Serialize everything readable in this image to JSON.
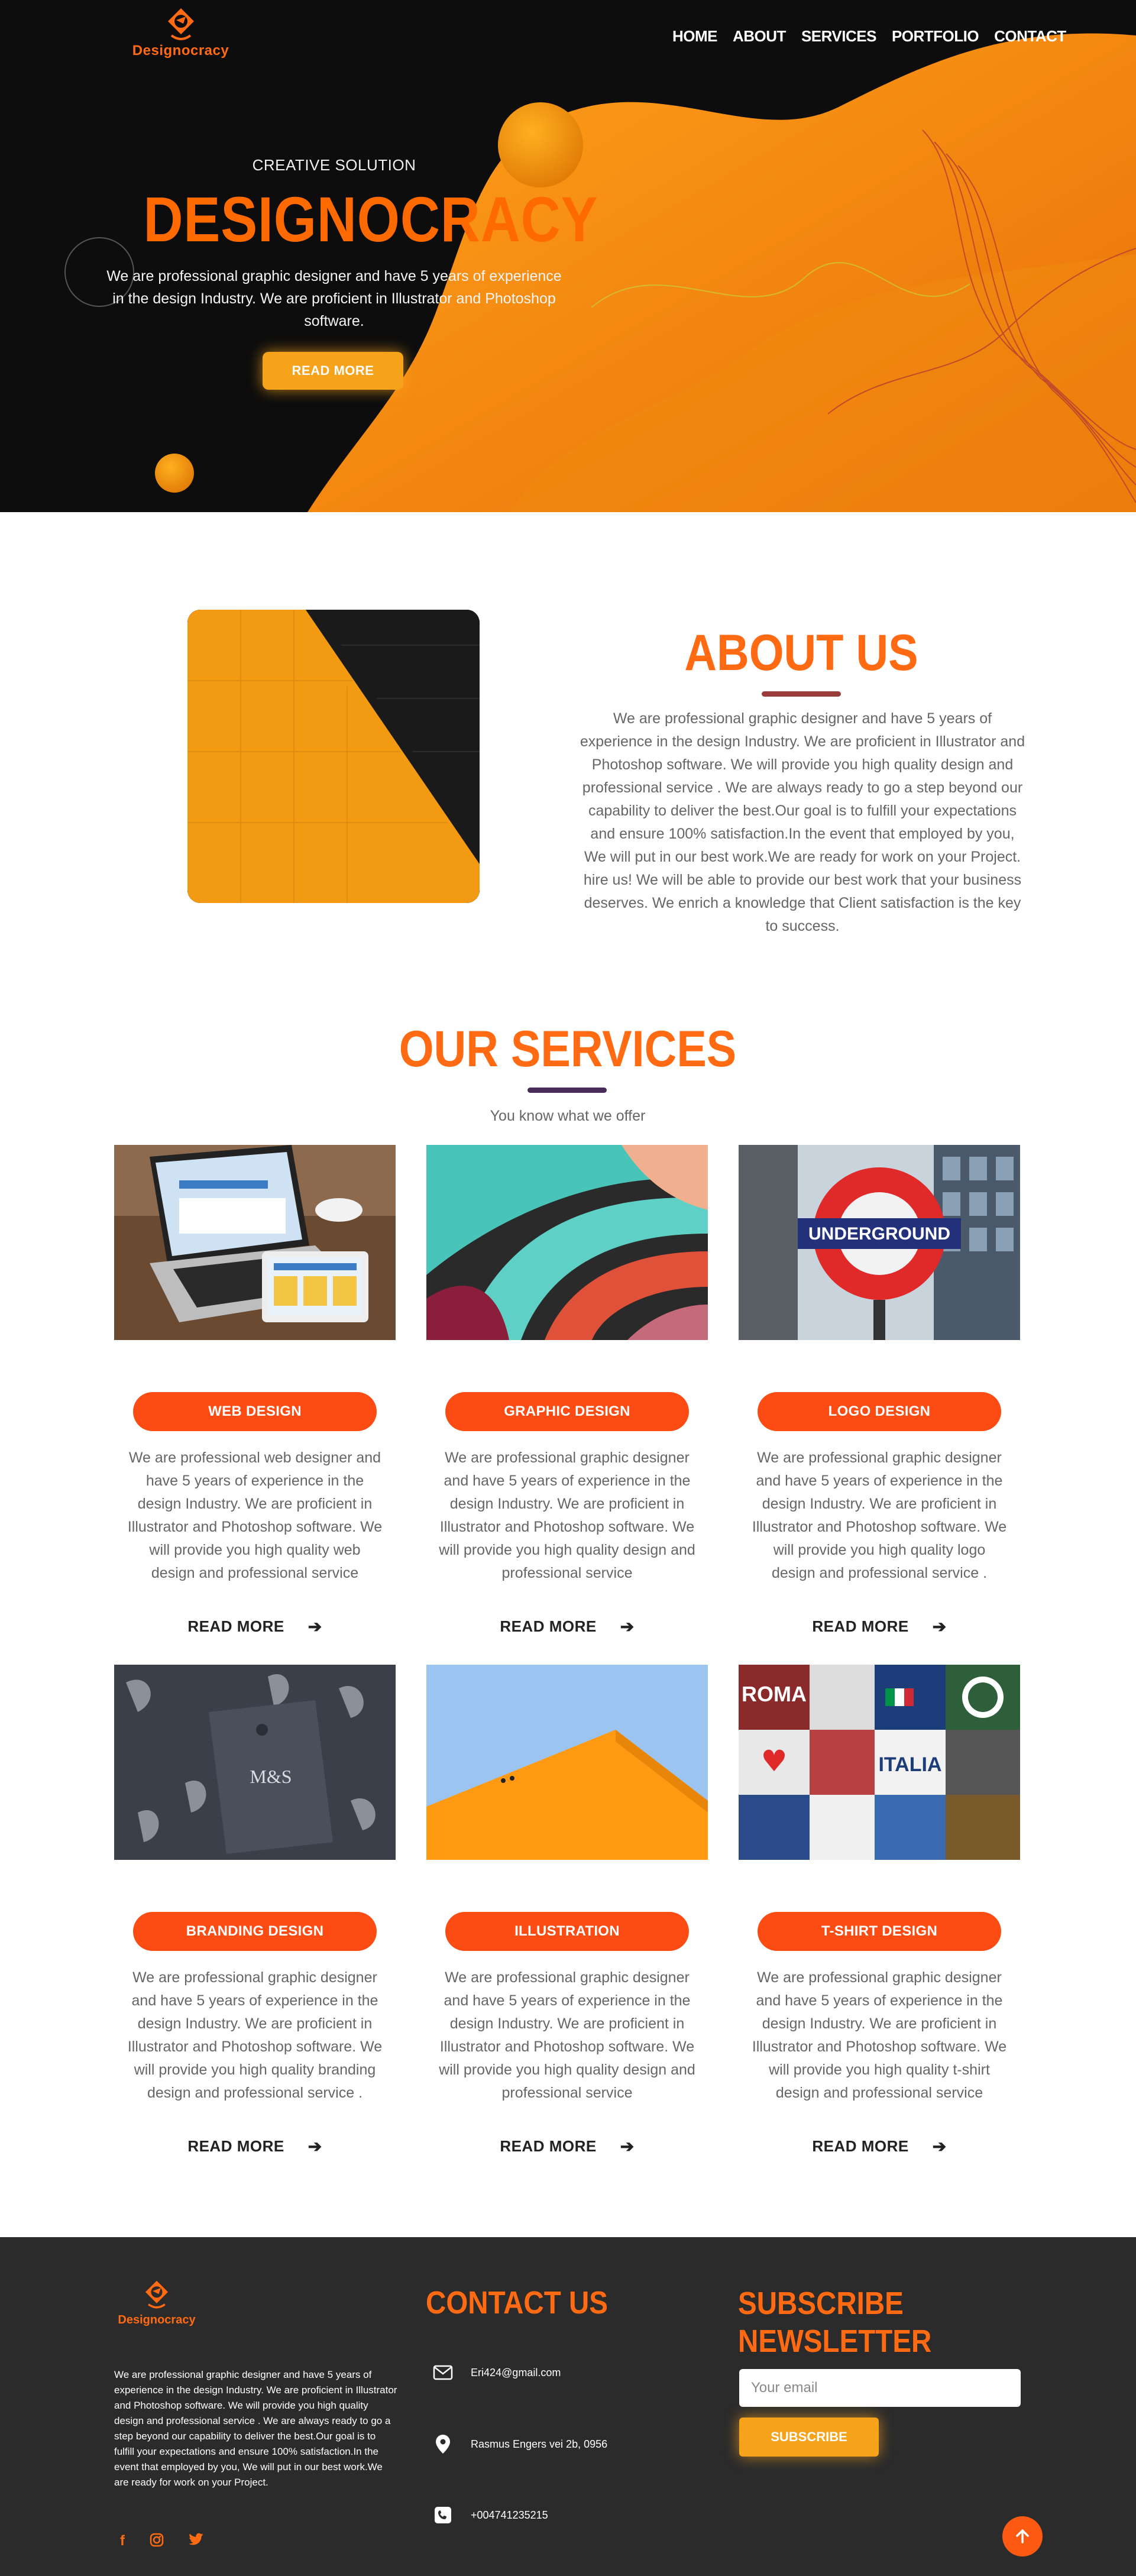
{
  "brand": {
    "name": "Designocracy",
    "accent": "#ff6a13"
  },
  "nav": {
    "items": [
      "HOME",
      "ABOUT",
      "SERVICES",
      "PORTFOLIO",
      "CONTACT"
    ]
  },
  "hero": {
    "subtitle": "CREATIVE SOLUTION",
    "title": "DESIGNOCRACY",
    "description": "We are professional graphic designer and have 5 years of experience in the design Industry. We are proficient in Illustrator and Photoshop software.",
    "button": "READ MORE"
  },
  "about": {
    "title": "ABOUT US",
    "text": "We are professional graphic designer and have 5 years of experience in the design Industry. We are proficient in Illustrator and Photoshop software. We will provide you high quality design and professional service . We are always ready to go a step beyond our capability to deliver the best.Our goal is to fulfill your expectations and ensure 100% satisfaction.In the event that employed by you, We will put in our best work.We are ready for work on your Project. hire us! We will be able to provide our best work that your business deserves. We enrich a knowledge that Client satisfaction is the key to success."
  },
  "services": {
    "title": "OUR SERVICES",
    "subtitle": "You know what we offer",
    "read_more": "READ MORE",
    "items": [
      {
        "label": "WEB DESIGN",
        "desc": "We are professional web designer and have 5 years of experience in the design Industry. We are proficient in Illustrator and Photoshop software. We will provide you high quality web design and professional service"
      },
      {
        "label": "GRAPHIC DESIGN",
        "desc": "We are professional graphic designer and have 5 years of experience in the design Industry. We are proficient in Illustrator and Photoshop software. We will provide you high quality design and professional service"
      },
      {
        "label": "LOGO DESIGN",
        "desc": "We are professional graphic designer and have 5 years of experience in the design Industry. We are proficient in Illustrator and Photoshop software. We will provide you high quality logo design and professional service ."
      },
      {
        "label": "BRANDING DESIGN",
        "desc": "We are professional graphic designer and have 5 years of experience in the design Industry. We are proficient in Illustrator and Photoshop software. We will provide you high quality branding design and professional service ."
      },
      {
        "label": "ILLUSTRATION",
        "desc": "We are professional graphic designer and have 5 years of experience in the design Industry. We are proficient in Illustrator and Photoshop software. We will provide you high quality design and professional service"
      },
      {
        "label": "T-SHIRT DESIGN",
        "desc": "We are professional graphic designer and have 5 years of experience in the design Industry. We are proficient in Illustrator and Photoshop software. We will provide you high quality t-shirt design and professional service"
      }
    ],
    "image_text": {
      "underground": "UNDERGROUND",
      "ms": "M&S",
      "rome": "ROMA",
      "italia": "ITALIA"
    }
  },
  "footer": {
    "about": "We are professional graphic designer and have 5 years of experience in the design Industry. We are proficient in Illustrator and Photoshop software. We will provide you high quality design and professional service . We are always ready to go a step beyond our capability to deliver the best.Our goal is to fulfill your expectations and ensure 100% satisfaction.In the event that employed by you, We will put in our best work.We are ready for work on your Project.",
    "contact_title": "CONTACT US",
    "email": "Eri424@gmail.com",
    "address": "Rasmus Engers vei 2b, 0956",
    "phone": "+004741235215",
    "newsletter_title_1": "SUBSCRIBE",
    "newsletter_title_2": "NEWSLETTER",
    "email_placeholder": "Your email",
    "subscribe": "SUBSCRIBE",
    "social": [
      "facebook-icon",
      "instagram-icon",
      "twitter-icon"
    ]
  }
}
